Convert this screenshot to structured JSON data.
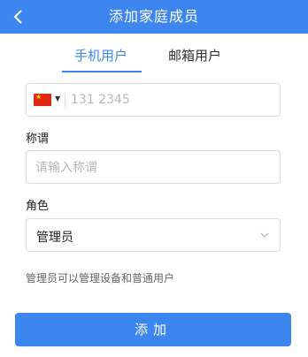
{
  "navbar": {
    "title": "添加家庭成员",
    "back_icon": "chevron-left-icon"
  },
  "tabs": [
    {
      "label": "手机用户",
      "active": true
    },
    {
      "label": "邮箱用户",
      "active": false
    }
  ],
  "phone": {
    "country_flag": "cn-flag-icon",
    "value": "131 2345"
  },
  "nickname": {
    "label": "称谓",
    "placeholder": "请输入称谓",
    "value": ""
  },
  "role": {
    "label": "角色",
    "selected": "管理员"
  },
  "helper_text": "管理员可以管理设备和普通用户",
  "submit_label": "添加",
  "colors": {
    "accent": "#3d86f0",
    "border": "#dcdcdc",
    "placeholder": "#b8b8b8"
  }
}
